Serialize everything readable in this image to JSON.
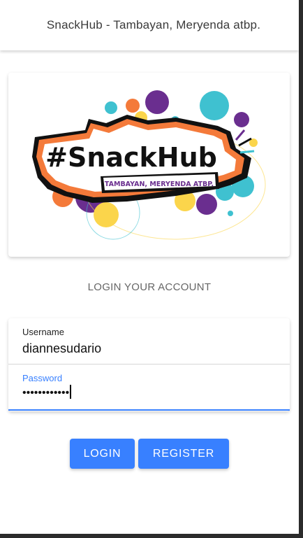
{
  "header": {
    "title": "SnackHub - Tambayan, Meryenda atbp."
  },
  "logo": {
    "wordmark": "#SnackHub",
    "tagline": "TAMBAYAN, MERYENDA ATBP.",
    "colors": {
      "teal": "#3fc1d0",
      "purple": "#6a2e8f",
      "orange": "#f47a3a",
      "yellow": "#fbd54b",
      "black": "#111111",
      "white": "#ffffff"
    }
  },
  "login": {
    "title": "LOGIN YOUR ACCOUNT",
    "username_label": "Username",
    "username_value": "diannesudario",
    "password_label": "Password",
    "password_value": "••••••••••••"
  },
  "buttons": {
    "login": "LOGIN",
    "register": "REGISTER"
  },
  "colors": {
    "accent": "#3880ff"
  }
}
